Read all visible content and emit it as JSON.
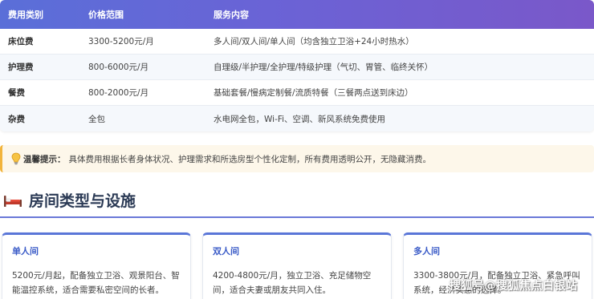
{
  "fee_table": {
    "headers": [
      "费用类别",
      "价格范围",
      "服务内容"
    ],
    "rows": [
      {
        "category": "床位费",
        "price": "3300-5200元/月",
        "service": "多人间/双人间/单人间（均含独立卫浴+24小时热水）"
      },
      {
        "category": "护理费",
        "price": "800-6000元/月",
        "service": "自理级/半护理/全护理/特级护理（气切、胃管、临终关怀）"
      },
      {
        "category": "餐费",
        "price": "800-2000元/月",
        "service": "基础套餐/慢病定制餐/流质特餐（三餐两点送到床边）"
      },
      {
        "category": "杂费",
        "price": "全包",
        "service": "水电网全包，Wi-Fi、空调、新风系统免费使用"
      }
    ]
  },
  "tip": {
    "icon": "lightbulb-icon",
    "label": "温馨提示：",
    "text": "具体费用根据长者身体状况、护理需求和所选房型个性化定制，所有费用透明公开，无隐藏消费。"
  },
  "section": {
    "icon": "bed-icon",
    "title": "房间类型与设施"
  },
  "rooms": [
    {
      "name": "单人间",
      "desc": "5200元/月起，配备独立卫浴、观景阳台、智能温控系统，适合需要私密空间的长者。"
    },
    {
      "name": "双人间",
      "desc": "4200-4800元/月，独立卫浴、充足储物空间，适合夫妻或朋友共同入住。"
    },
    {
      "name": "多人间",
      "desc": "3300-3800元/月，配备独立卫浴、紧急呼叫系统，经济实惠的选择。"
    }
  ],
  "watermark": "搜狐号@搜狐焦点白银站",
  "colors": {
    "header_gradient_start": "#5a6fd8",
    "header_gradient_end": "#7a58c9",
    "tip_border": "#f2b43c",
    "accent_blue": "#3a5bc7"
  }
}
